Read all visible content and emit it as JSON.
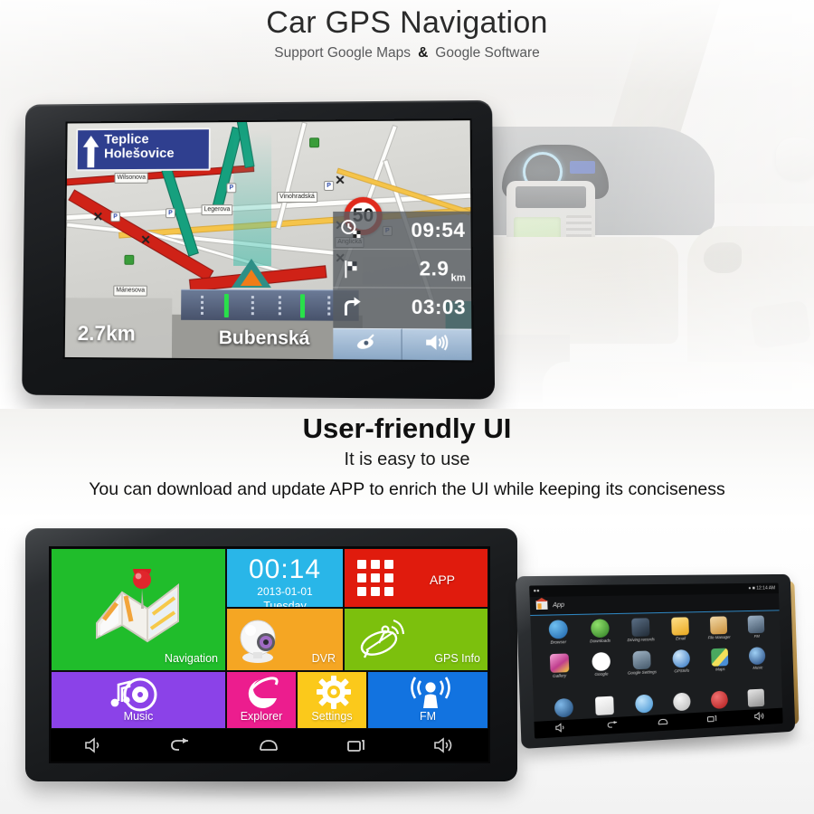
{
  "header": {
    "title": "Car GPS Navigation",
    "subtitle_left": "Support Google Maps",
    "subtitle_amp": "&",
    "subtitle_right": "Google Software"
  },
  "mid": {
    "title": "User-friendly UI",
    "subtitle": "It is easy to use",
    "line": "You can download and update APP to enrich the UI while keeping its  conciseness"
  },
  "gps_screen": {
    "sign": {
      "line1": "Teplice",
      "line2": "Holešovice",
      "arrow": "straight-ahead-arrow-icon"
    },
    "speed_limit": "50",
    "distance_to_turn": "2.7km",
    "current_street": "Bubenská",
    "street_labels": [
      "Vinohradská",
      "Mánesova",
      "Legerova",
      "Wilsonova",
      "Anglická"
    ],
    "panel": [
      {
        "icon": "arrival-clock-icon",
        "value": "09:54",
        "unit": ""
      },
      {
        "icon": "checkered-flag-icon",
        "value": "2.9",
        "unit": "km"
      },
      {
        "icon": "turn-right-icon",
        "value": "03:03",
        "unit": ""
      }
    ],
    "buttons": [
      {
        "name": "satellite-button",
        "icon": "satellite-dish-icon"
      },
      {
        "name": "volume-button",
        "icon": "speaker-icon"
      }
    ]
  },
  "tile_ui": {
    "tiles": [
      {
        "name": "navigation",
        "label": "Navigation",
        "color": "#20bd2b",
        "icon": "folded-map-pin-icon"
      },
      {
        "name": "clock",
        "label": "",
        "color": "#29b6e8",
        "icon": "clock-tile",
        "time": "00:14",
        "date": "2013-01-01",
        "weekday": "Tuesday"
      },
      {
        "name": "app",
        "label": "APP",
        "color": "#e01b0d",
        "icon": "grid-apps-icon"
      },
      {
        "name": "dvr",
        "label": "DVR",
        "color": "#f5a623",
        "icon": "camera-icon"
      },
      {
        "name": "gps-info",
        "label": "GPS Info",
        "color": "#7cc00d",
        "icon": "satellite-dish-icon"
      },
      {
        "name": "music",
        "label": "Music",
        "color": "#8b42e8",
        "icon": "music-note-disc-icon"
      },
      {
        "name": "explorer",
        "label": "Explorer",
        "color": "#ec1d8e",
        "icon": "browser-e-icon"
      },
      {
        "name": "settings",
        "label": "Settings",
        "color": "#fbc91b",
        "icon": "gear-icon"
      },
      {
        "name": "fm",
        "label": "FM",
        "color": "#1273e0",
        "icon": "radio-broadcast-icon"
      }
    ],
    "navbar": [
      {
        "name": "volume-down-button",
        "icon": "volume-down-icon"
      },
      {
        "name": "back-button",
        "icon": "back-arrow-icon"
      },
      {
        "name": "home-button",
        "icon": "home-icon"
      },
      {
        "name": "recents-button",
        "icon": "recents-icon"
      },
      {
        "name": "volume-up-button",
        "icon": "volume-up-icon"
      }
    ]
  },
  "tablet": {
    "status_time": "12:14 AM",
    "status_icons": [
      "location-icon",
      "battery-icon"
    ],
    "title": "App",
    "title_icon": "home-app-icon",
    "apps": [
      {
        "label": "Browser",
        "icon": "globe-icon",
        "color": "#2a7fd4"
      },
      {
        "label": "Downloads",
        "icon": "download-arrow-icon",
        "color": "#3f9c35"
      },
      {
        "label": "Driving records",
        "icon": "driving-record-icon",
        "color": "#3a4c63"
      },
      {
        "label": "Email",
        "icon": "envelope-icon",
        "color": "#f2c341"
      },
      {
        "label": "File Manager",
        "icon": "file-folder-icon",
        "color": "#d9a04a"
      },
      {
        "label": "FM",
        "icon": "radio-icon",
        "color": "#5b6b7d"
      },
      {
        "label": "Gallery",
        "icon": "photo-icon",
        "color": "#d94f9c"
      },
      {
        "label": "Google",
        "icon": "google-g-icon",
        "color": "#ffffff"
      },
      {
        "label": "Google Settings",
        "icon": "google-gear-icon",
        "color": "#4d6070"
      },
      {
        "label": "GPSInfo",
        "icon": "compass-icon",
        "color": "#3c86d6"
      },
      {
        "label": "Maps",
        "icon": "maps-pin-icon",
        "color": "#3fa85f"
      },
      {
        "label": "Music",
        "icon": "music-circle-icon",
        "color": "#2b5fa8"
      }
    ],
    "dock": [
      {
        "label": "",
        "icon": "video-player-icon",
        "color": "#2b6fc4"
      },
      {
        "label": "",
        "icon": "play-store-icon",
        "color": "#e8e8e8"
      },
      {
        "label": "",
        "icon": "search-icon",
        "color": "#4aa3e0"
      },
      {
        "label": "",
        "icon": "gear-icon",
        "color": "#e0e0e0"
      },
      {
        "label": "",
        "icon": "alert-icon",
        "color": "#d02020"
      },
      {
        "label": "",
        "icon": "movie-clapper-icon",
        "color": "#c9c9c9"
      }
    ],
    "navbar": [
      {
        "name": "volume-down-button",
        "icon": "volume-down-icon"
      },
      {
        "name": "back-button",
        "icon": "back-arrow-icon"
      },
      {
        "name": "home-button",
        "icon": "home-icon"
      },
      {
        "name": "recents-button",
        "icon": "recents-icon"
      },
      {
        "name": "volume-up-button",
        "icon": "volume-up-icon"
      }
    ]
  }
}
